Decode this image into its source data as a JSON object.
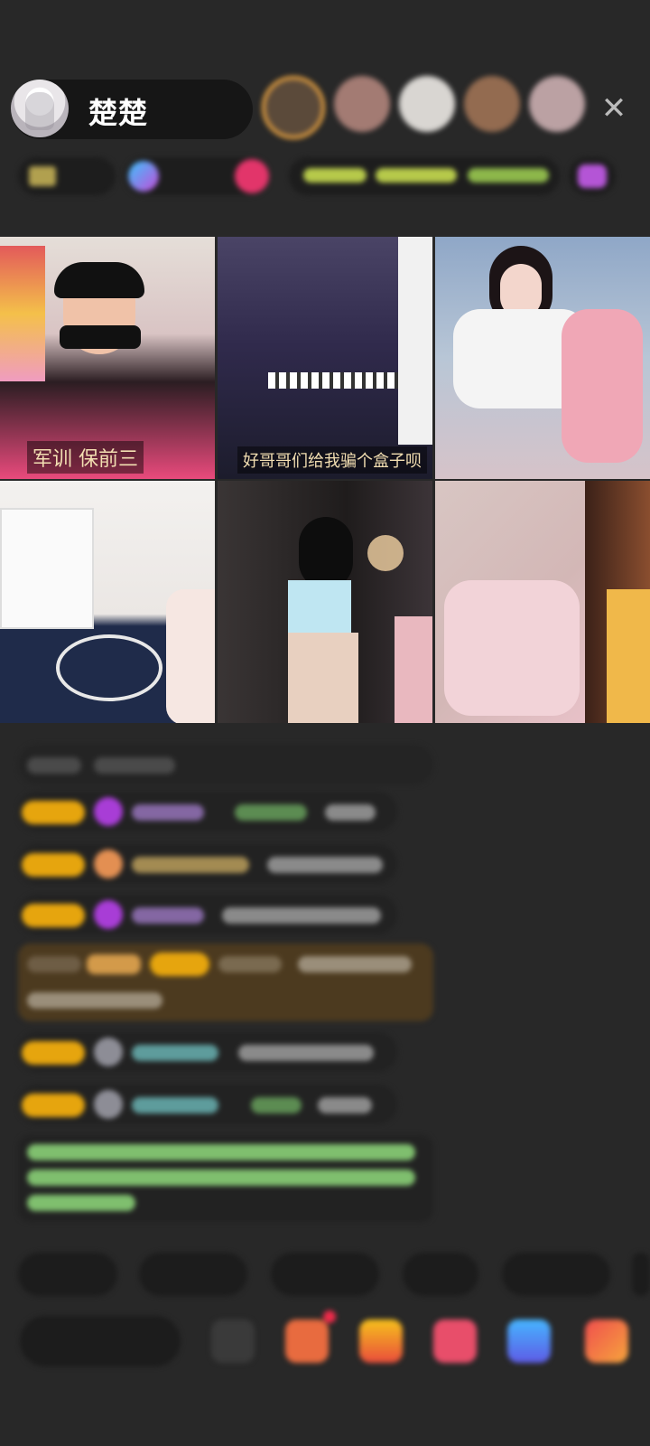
{
  "host": {
    "name": "楚楚"
  },
  "grid": {
    "captions": [
      "军训 保前三",
      "好哥哥们给我骗个盒子呗"
    ]
  },
  "colors": {
    "background": "#282828",
    "badge": "#e6a50e",
    "gem": "#a83dd6",
    "ring": "#e6a141",
    "system_text": "#8fd27e"
  },
  "icons": [
    "close-icon",
    "gift-icon",
    "more-icon"
  ]
}
